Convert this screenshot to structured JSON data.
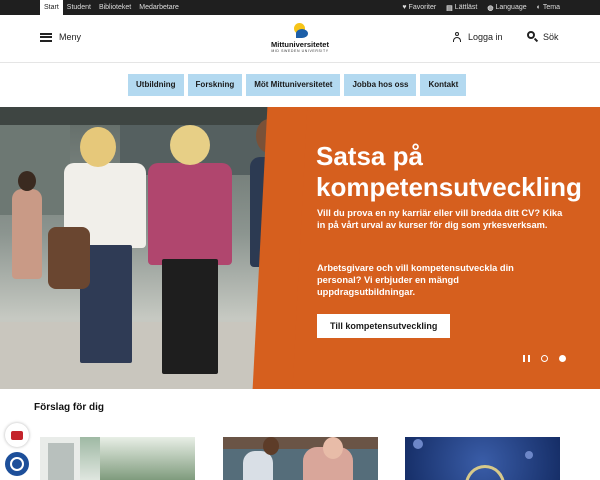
{
  "topbar": {
    "nav": [
      "Start",
      "Student",
      "Biblioteket",
      "Medarbetare"
    ],
    "tools": [
      {
        "label": "Favoriter",
        "icon": "heart-icon",
        "glyph": "♥"
      },
      {
        "label": "Lättläst",
        "icon": "book-icon",
        "glyph": "▤"
      },
      {
        "label": "Language",
        "icon": "globe-icon",
        "glyph": "◍"
      },
      {
        "label": "Tema",
        "icon": "palette-icon",
        "glyph": "◐"
      }
    ]
  },
  "header": {
    "menu_label": "Meny",
    "logo_name": "Mittuniversitetet",
    "logo_sub": "MID SWEDEN UNIVERSITY",
    "login_label": "Logga in",
    "search_label": "Sök"
  },
  "catnav": [
    "Utbildning",
    "Forskning",
    "Möt Mittuniversitetet",
    "Jobba hos oss",
    "Kontakt"
  ],
  "hero": {
    "title": "Satsa på kompetensutveckling",
    "p1": "Vill du prova en ny karriär eller vill bredda ditt CV? Kika in på vårt urval av kurser för dig som yrkesverksam.",
    "p2": "Arbetsgivare och vill kompetensutveckla din personal? Vi erbjuder en mängd uppdragsutbildningar.",
    "button": "Till kompetensutveckling",
    "slides": 2,
    "active_slide": 2
  },
  "suggestions": {
    "title": "Förslag för dig"
  },
  "colors": {
    "accent_orange": "#d65f1e",
    "nav_blue": "#b3d9f0",
    "topbar": "#1f1f1f"
  }
}
